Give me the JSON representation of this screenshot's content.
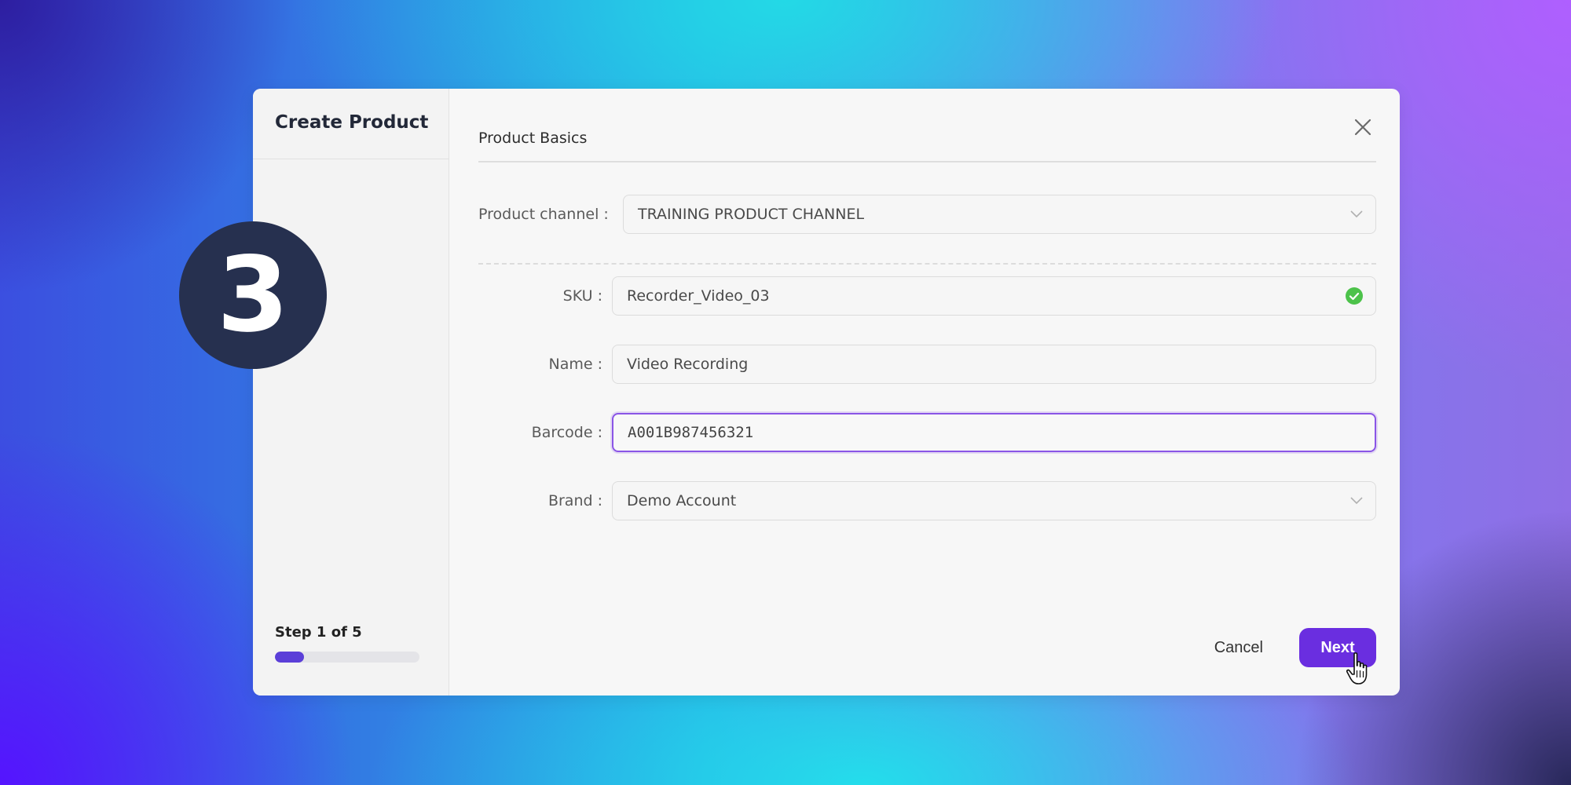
{
  "step_badge": "3",
  "sidebar": {
    "title": "Create Product",
    "step_label": "Step 1 of 5",
    "progress_fraction": 0.2
  },
  "section": {
    "title": "Product Basics"
  },
  "form": {
    "product_channel": {
      "label": "Product channel :",
      "value": "TRAINING PRODUCT CHANNEL"
    },
    "sku": {
      "label": "SKU :",
      "value": "Recorder_Video_03",
      "status": "valid"
    },
    "name": {
      "label": "Name :",
      "value": "Video Recording"
    },
    "barcode": {
      "label": "Barcode :",
      "value": "A001B987456321"
    },
    "brand": {
      "label": "Brand :",
      "value": "Demo Account"
    }
  },
  "footer": {
    "cancel_label": "Cancel",
    "next_label": "Next"
  },
  "colors": {
    "accent": "#6a2ee0",
    "focus_border": "#8a55e6",
    "valid_green": "#4cc24a",
    "badge_bg": "#26304f"
  },
  "icons": {
    "close": "close-icon",
    "dropdown": "chevron-down-icon",
    "valid": "check-circle-icon",
    "cursor": "hand-pointer-icon"
  }
}
